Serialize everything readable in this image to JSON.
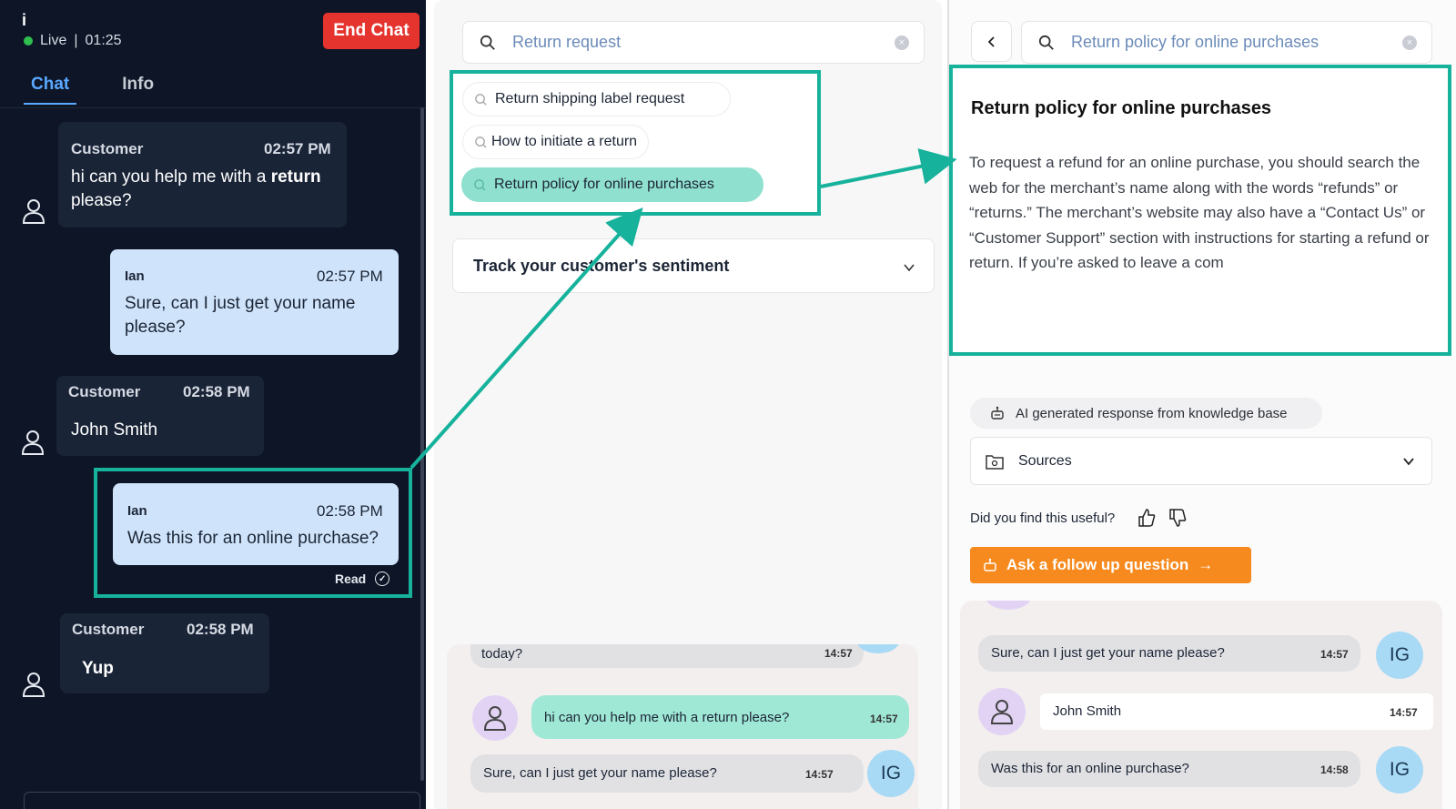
{
  "left": {
    "info_glyph": "i",
    "live_label": "Live",
    "timer": "01:25",
    "end_chat_label": "End Chat",
    "tabs": [
      {
        "label": "Chat"
      },
      {
        "label": "Info"
      }
    ],
    "messages": [
      {
        "sender": "Customer",
        "time": "02:57 PM",
        "text_pre": "hi can you help me with a ",
        "text_bold": "return",
        "text_post": "please?"
      },
      {
        "sender": "Ian",
        "time": "02:57 PM",
        "text": "Sure, can I just get your name please?"
      },
      {
        "sender": "Customer",
        "time": "02:58 PM",
        "text": "John Smith"
      },
      {
        "sender": "Ian",
        "time": "02:58 PM",
        "text": "Was this for an online purchase?"
      },
      {
        "sender": "Customer",
        "time": "02:58 PM",
        "text": "Yup"
      }
    ],
    "read_label": "Read"
  },
  "middle": {
    "search_value": "Return request",
    "suggestions": [
      {
        "label": "Return shipping label request"
      },
      {
        "label": "How to initiate a return"
      },
      {
        "label": "Return policy for online purchases"
      }
    ],
    "sentiment_title": "Track your customer's sentiment",
    "chat": [
      {
        "text": "today?",
        "time": "14:57"
      },
      {
        "text_pre": "hi can you help me with a ",
        "text_mid": "return",
        "text_post": " please?",
        "time": "14:57"
      },
      {
        "text": "Sure, can I just get your name please?",
        "time": "14:57",
        "avatar": "IG"
      }
    ]
  },
  "right": {
    "search_value": "Return policy for online purchases",
    "answer_title": "Return policy for online purchases",
    "answer_body": "To request a refund for an online purchase, you should search the web for the merchant’s name along with the words “refunds” or “returns.” The merchant’s website may also have a “Contact Us” or “Customer Support” section with instructions for starting a refund or return. If you’re asked to leave a com",
    "ai_label": "AI generated response from knowledge base",
    "sources_label": "Sources",
    "useful_label": "Did you find this useful?",
    "follow_up_label": "Ask a follow up question",
    "chat": [
      {
        "text": "Sure, can I just get your name please?",
        "time": "14:57",
        "avatar": "IG"
      },
      {
        "text": "John Smith",
        "time": "14:57"
      },
      {
        "text": "Was this for an online purchase?",
        "time": "14:58",
        "avatar": "IG"
      }
    ]
  },
  "colors": {
    "highlight": "#16b29b",
    "end_chat": "#e5332e",
    "follow_up": "#f68a1e",
    "selected_chip": "#8fe0cf"
  }
}
